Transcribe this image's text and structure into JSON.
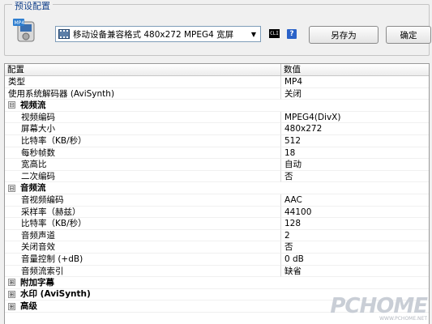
{
  "preset": {
    "legend": "预设配置",
    "selected": "移动设备兼容格式 480x272 MPEG4 宽屏",
    "cli_icon_text": "CLI",
    "help_text": "?",
    "save_as_label": "另存为",
    "ok_label": "确定"
  },
  "grid": {
    "headers": {
      "key": "配置",
      "value": "数值"
    },
    "top": [
      {
        "label": "类型",
        "value": "MP4"
      },
      {
        "label": "使用系统解码器 (AviSynth)",
        "value": "关闭"
      }
    ],
    "video": {
      "label": "视频流",
      "expander": "⊟",
      "items": [
        {
          "label": "视频编码",
          "value": "MPEG4(DivX)"
        },
        {
          "label": "屏幕大小",
          "value": "480x272"
        },
        {
          "label": "比特率（KB/秒）",
          "value": "512"
        },
        {
          "label": "每秒帧数",
          "value": "18"
        },
        {
          "label": "宽高比",
          "value": "自动"
        },
        {
          "label": "二次编码",
          "value": "否"
        }
      ]
    },
    "audio": {
      "label": "音频流",
      "expander": "⊟",
      "items": [
        {
          "label": "音视频编码",
          "value": "AAC"
        },
        {
          "label": "采样率（赫兹）",
          "value": "44100"
        },
        {
          "label": "比特率（KB/秒）",
          "value": "128"
        },
        {
          "label": "音频声道",
          "value": "2"
        },
        {
          "label": "关闭音效",
          "value": "否"
        },
        {
          "label": "音量控制 (+dB)",
          "value": "0 dB"
        },
        {
          "label": "音频流索引",
          "value": "缺省"
        }
      ]
    },
    "collapsed": [
      {
        "label": "附加字幕",
        "expander": "⊞"
      },
      {
        "label": "水印 (AviSynth)",
        "expander": "⊞"
      },
      {
        "label": "高级",
        "expander": "⊞"
      }
    ]
  },
  "watermark": {
    "logo": "PCHOME",
    "url": "WWW.PCHOME.NET"
  },
  "icons": {
    "device": "mp4-device-icon",
    "format": "film-icon",
    "dropdown": "chevron-down-icon",
    "cli": "command-line-icon",
    "help": "help-icon"
  },
  "colors": {
    "legend": "#15428b",
    "help": "#2a62c8",
    "grid_border": "#9a9a9a"
  }
}
